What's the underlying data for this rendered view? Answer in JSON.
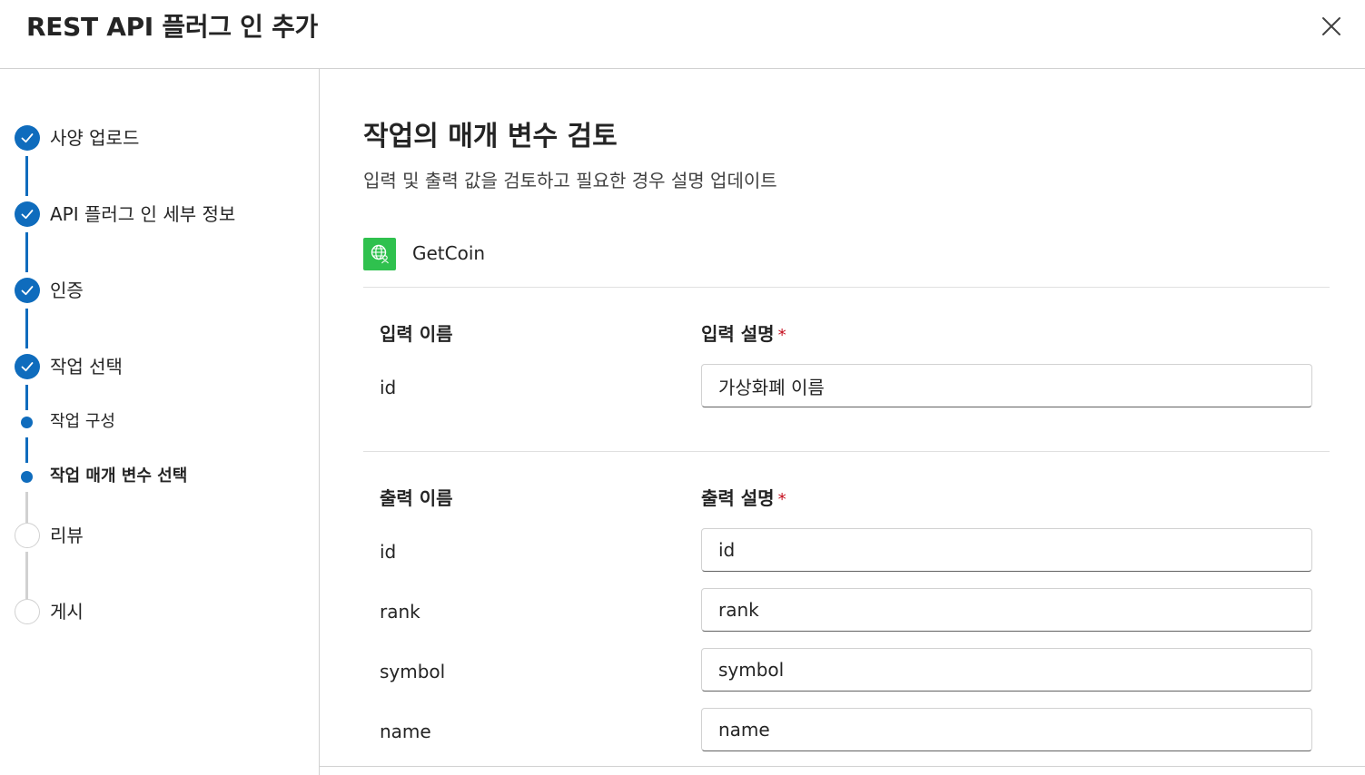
{
  "dialog": {
    "title": "REST API 플러그 인 추가"
  },
  "steps": [
    {
      "label": "사양 업로드",
      "status": "completed"
    },
    {
      "label": "API 플러그 인 세부 정보",
      "status": "completed"
    },
    {
      "label": "인증",
      "status": "completed"
    },
    {
      "label": "작업 선택",
      "status": "completed"
    },
    {
      "label": "작업 구성",
      "status": "completed-substep"
    },
    {
      "label": "작업 매개 변수 선택",
      "status": "current-substep"
    },
    {
      "label": "리뷰",
      "status": "pending"
    },
    {
      "label": "게시",
      "status": "pending"
    }
  ],
  "main": {
    "title": "작업의 매개 변수 검토",
    "subtitle": "입력 및 출력 값을 검토하고 필요한 경우 설명 업데이트",
    "operation": {
      "name": "GetCoin",
      "icon": "globe-people-icon"
    },
    "inputs": {
      "name_header": "입력 이름",
      "desc_header": "입력 설명",
      "required_mark": "*",
      "rows": [
        {
          "name": "id",
          "description": "가상화폐 이름"
        }
      ]
    },
    "outputs": {
      "name_header": "출력 이름",
      "desc_header": "출력 설명",
      "required_mark": "*",
      "rows": [
        {
          "name": "id",
          "description": "id"
        },
        {
          "name": "rank",
          "description": "rank"
        },
        {
          "name": "symbol",
          "description": "symbol"
        },
        {
          "name": "name",
          "description": "name"
        }
      ]
    }
  },
  "colors": {
    "accent": "#0f6cbd",
    "icon_bg": "#2fc14e",
    "required": "#c50f1f"
  }
}
